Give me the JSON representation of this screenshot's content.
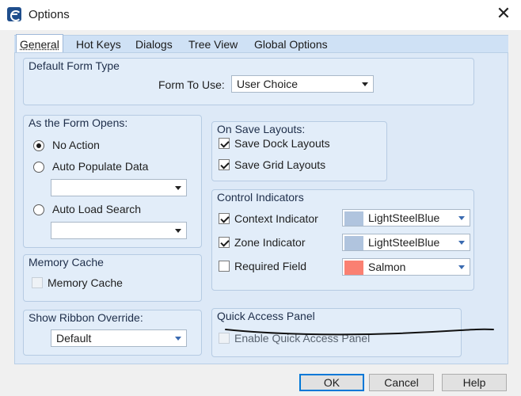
{
  "window": {
    "title": "Options",
    "close_label": "✕"
  },
  "tabs": [
    "General",
    "Hot Keys",
    "Dialogs",
    "Tree View",
    "Global Options"
  ],
  "default_form_type": {
    "title": "Default Form Type",
    "form_to_use_label": "Form To Use:",
    "form_to_use_value": "User Choice"
  },
  "as_form_opens": {
    "title": "As the Form Opens:",
    "no_action": "No Action",
    "auto_populate": "Auto Populate Data",
    "auto_load": "Auto Load Search",
    "selected": "No Action"
  },
  "on_save_layouts": {
    "title": "On Save Layouts:",
    "save_dock": "Save Dock Layouts",
    "save_grid": "Save Grid Layouts"
  },
  "control_indicators": {
    "title": "Control Indicators",
    "context": {
      "label": "Context Indicator",
      "color_name": "LightSteelBlue",
      "color": "#b0c4de",
      "checked": true
    },
    "zone": {
      "label": "Zone Indicator",
      "color_name": "LightSteelBlue",
      "color": "#b0c4de",
      "checked": true
    },
    "required": {
      "label": "Required Field",
      "color_name": "Salmon",
      "color": "#fa8072",
      "checked": false
    }
  },
  "memory_cache": {
    "title": "Memory Cache",
    "checkbox_label": "Memory Cache"
  },
  "show_ribbon_override": {
    "title": "Show Ribbon Override:",
    "value": "Default"
  },
  "quick_access_panel": {
    "title": "Quick Access Panel",
    "checkbox_label": "Enable Quick Access Panel"
  },
  "buttons": {
    "ok": "OK",
    "cancel": "Cancel",
    "help": "Help"
  },
  "colors": {
    "tab_active": "#ffffff",
    "accent": "#0078d7"
  }
}
